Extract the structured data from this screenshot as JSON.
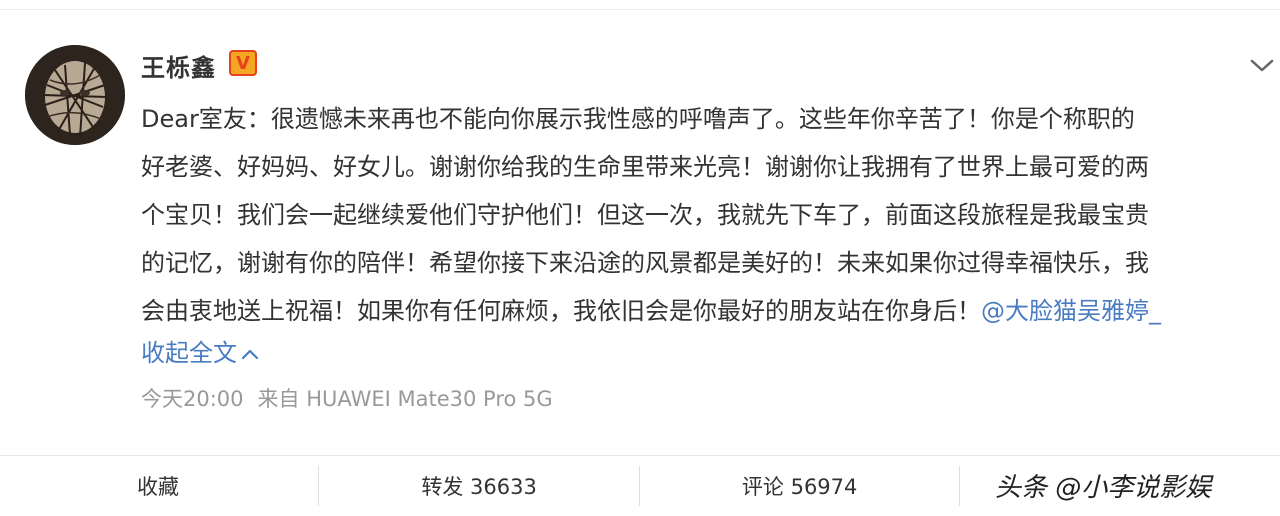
{
  "post": {
    "author": "王栎鑫",
    "verified_mark": "V",
    "lines": [
      "Dear室友：很遗憾未来再也不能向你展示我性感的呼噜声了。这些年你辛苦了！你是个称职的",
      "好老婆、好妈妈、好女儿。谢谢你给我的生命里带来光亮！谢谢你让我拥有了世界上最可爱的两",
      "个宝贝！我们会一起继续爱他们守护他们！但这一次，我就先下车了，前面这段旅程是我最宝贵",
      "的记忆，谢谢有你的陪伴！希望你接下来沿途的风景都是美好的！未来如果你过得幸福快乐，我",
      "会由衷地送上祝福！如果你有任何麻烦，我依旧会是你最好的朋友站在你身后！"
    ],
    "mention": "@大脸猫吴雅婷_",
    "collapse_label": "收起全文",
    "time": "今天20:00",
    "source": "来自 HUAWEI Mate30 Pro 5G"
  },
  "footer": {
    "favorite_label": "收藏",
    "repost_label": "转发 36633",
    "comment_label": "评论 56974"
  },
  "watermark": "头条 @小李说影娱",
  "colors": {
    "link": "#4a7cc2",
    "text": "#333333",
    "meta": "#999999",
    "badge": "#f5a623"
  },
  "icons": [
    "chevron-down-icon",
    "chevron-up-icon",
    "verified-icon"
  ]
}
